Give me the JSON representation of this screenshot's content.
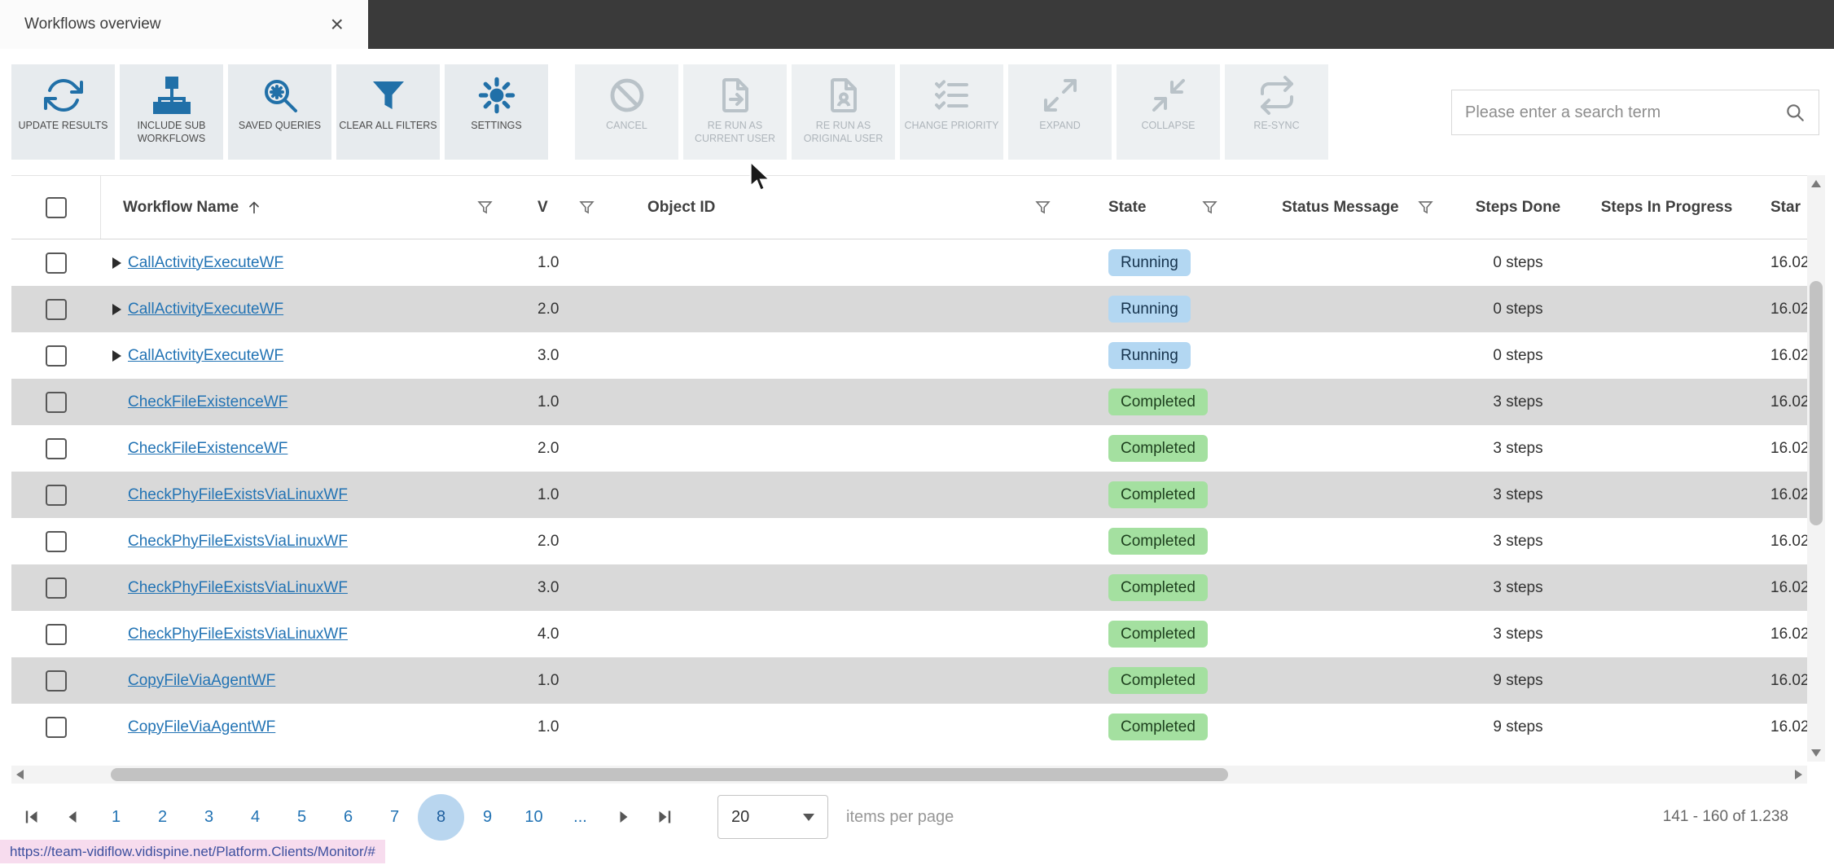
{
  "theme": {
    "accent": "#2170a8",
    "topbar_bg": "#3a3a3a",
    "row_alt_bg": "#d9d9d9",
    "link_color": "#2273b4",
    "selected_page_bg": "#b9d6ef",
    "state_colors": {
      "Running": {
        "bg": "#b3d7f2",
        "text": "#16334d"
      },
      "Completed": {
        "bg": "#a4e0a0",
        "text": "#1d3f1d"
      }
    }
  },
  "window": {
    "tab_title": "Workflows overview",
    "close_label": "×"
  },
  "toolbar": {
    "search_placeholder": "Please enter a search term",
    "buttons": [
      {
        "label": "UPDATE RESULTS",
        "icon": "refresh-icon",
        "enabled": true
      },
      {
        "label": "INCLUDE SUB WORKFLOWS",
        "icon": "sub-workflows-icon",
        "enabled": true
      },
      {
        "label": "SAVED QUERIES",
        "icon": "saved-queries-icon",
        "enabled": true
      },
      {
        "label": "CLEAR ALL FILTERS",
        "icon": "clear-filters-icon",
        "enabled": true
      },
      {
        "label": "SETTINGS",
        "icon": "settings-gear-icon",
        "enabled": true
      },
      {
        "label": "CANCEL",
        "icon": "cancel-icon",
        "enabled": false
      },
      {
        "label": "RE RUN AS CURRENT USER",
        "icon": "rerun-current-user-icon",
        "enabled": false
      },
      {
        "label": "RE RUN AS ORIGINAL USER",
        "icon": "rerun-original-user-icon",
        "enabled": false
      },
      {
        "label": "CHANGE PRIORITY",
        "icon": "change-priority-icon",
        "enabled": false
      },
      {
        "label": "EXPAND",
        "icon": "expand-icon",
        "enabled": false
      },
      {
        "label": "COLLAPSE",
        "icon": "collapse-icon",
        "enabled": false
      },
      {
        "label": "RE-SYNC",
        "icon": "resync-icon",
        "enabled": false
      }
    ]
  },
  "table": {
    "columns": [
      {
        "label": "",
        "key": "select",
        "filter": false
      },
      {
        "label": "Workflow Name",
        "key": "name",
        "filter": true,
        "sorted": "asc"
      },
      {
        "label": "V",
        "key": "version",
        "filter": true
      },
      {
        "label": "Object ID",
        "key": "object_id",
        "filter": true
      },
      {
        "label": "State",
        "key": "state",
        "filter": true
      },
      {
        "label": "Status Message",
        "key": "status_message",
        "filter": true
      },
      {
        "label": "Steps Done",
        "key": "steps_done",
        "filter": false
      },
      {
        "label": "Steps In Progress",
        "key": "steps_in_progress",
        "filter": false
      },
      {
        "label": "Star",
        "key": "started",
        "filter": false
      }
    ],
    "rows": [
      {
        "expandable": true,
        "name": "CallActivityExecuteWF",
        "version": "1.0",
        "object_id": "",
        "state": "Running",
        "status_message": "",
        "steps_done": "0 steps",
        "steps_in_progress": "",
        "started": "16.02"
      },
      {
        "expandable": true,
        "name": "CallActivityExecuteWF",
        "version": "2.0",
        "object_id": "",
        "state": "Running",
        "status_message": "",
        "steps_done": "0 steps",
        "steps_in_progress": "",
        "started": "16.02"
      },
      {
        "expandable": true,
        "name": "CallActivityExecuteWF",
        "version": "3.0",
        "object_id": "",
        "state": "Running",
        "status_message": "",
        "steps_done": "0 steps",
        "steps_in_progress": "",
        "started": "16.02"
      },
      {
        "expandable": false,
        "name": "CheckFileExistenceWF",
        "version": "1.0",
        "object_id": "",
        "state": "Completed",
        "status_message": "",
        "steps_done": "3 steps",
        "steps_in_progress": "",
        "started": "16.02"
      },
      {
        "expandable": false,
        "name": "CheckFileExistenceWF",
        "version": "2.0",
        "object_id": "",
        "state": "Completed",
        "status_message": "",
        "steps_done": "3 steps",
        "steps_in_progress": "",
        "started": "16.02"
      },
      {
        "expandable": false,
        "name": "CheckPhyFileExistsViaLinuxWF",
        "version": "1.0",
        "object_id": "",
        "state": "Completed",
        "status_message": "",
        "steps_done": "3 steps",
        "steps_in_progress": "",
        "started": "16.02"
      },
      {
        "expandable": false,
        "name": "CheckPhyFileExistsViaLinuxWF",
        "version": "2.0",
        "object_id": "",
        "state": "Completed",
        "status_message": "",
        "steps_done": "3 steps",
        "steps_in_progress": "",
        "started": "16.02"
      },
      {
        "expandable": false,
        "name": "CheckPhyFileExistsViaLinuxWF",
        "version": "3.0",
        "object_id": "",
        "state": "Completed",
        "status_message": "",
        "steps_done": "3 steps",
        "steps_in_progress": "",
        "started": "16.02"
      },
      {
        "expandable": false,
        "name": "CheckPhyFileExistsViaLinuxWF",
        "version": "4.0",
        "object_id": "",
        "state": "Completed",
        "status_message": "",
        "steps_done": "3 steps",
        "steps_in_progress": "",
        "started": "16.02"
      },
      {
        "expandable": false,
        "name": "CopyFileViaAgentWF",
        "version": "1.0",
        "object_id": "",
        "state": "Completed",
        "status_message": "",
        "steps_done": "9 steps",
        "steps_in_progress": "",
        "started": "16.02"
      },
      {
        "expandable": false,
        "name": "CopyFileViaAgentWF",
        "version": "1.0",
        "object_id": "",
        "state": "Completed",
        "status_message": "",
        "steps_done": "9 steps",
        "steps_in_progress": "",
        "started": "16.02"
      }
    ]
  },
  "pagination": {
    "pages": [
      "1",
      "2",
      "3",
      "4",
      "5",
      "6",
      "7",
      "8",
      "9",
      "10",
      "..."
    ],
    "current_page": "8",
    "page_size": "20",
    "items_per_page_label": "items per page",
    "range_label": "141 - 160 of 1.238"
  },
  "status_bar": {
    "url": "https://team-vidiflow.vidispine.net/Platform.Clients/Monitor/#"
  }
}
